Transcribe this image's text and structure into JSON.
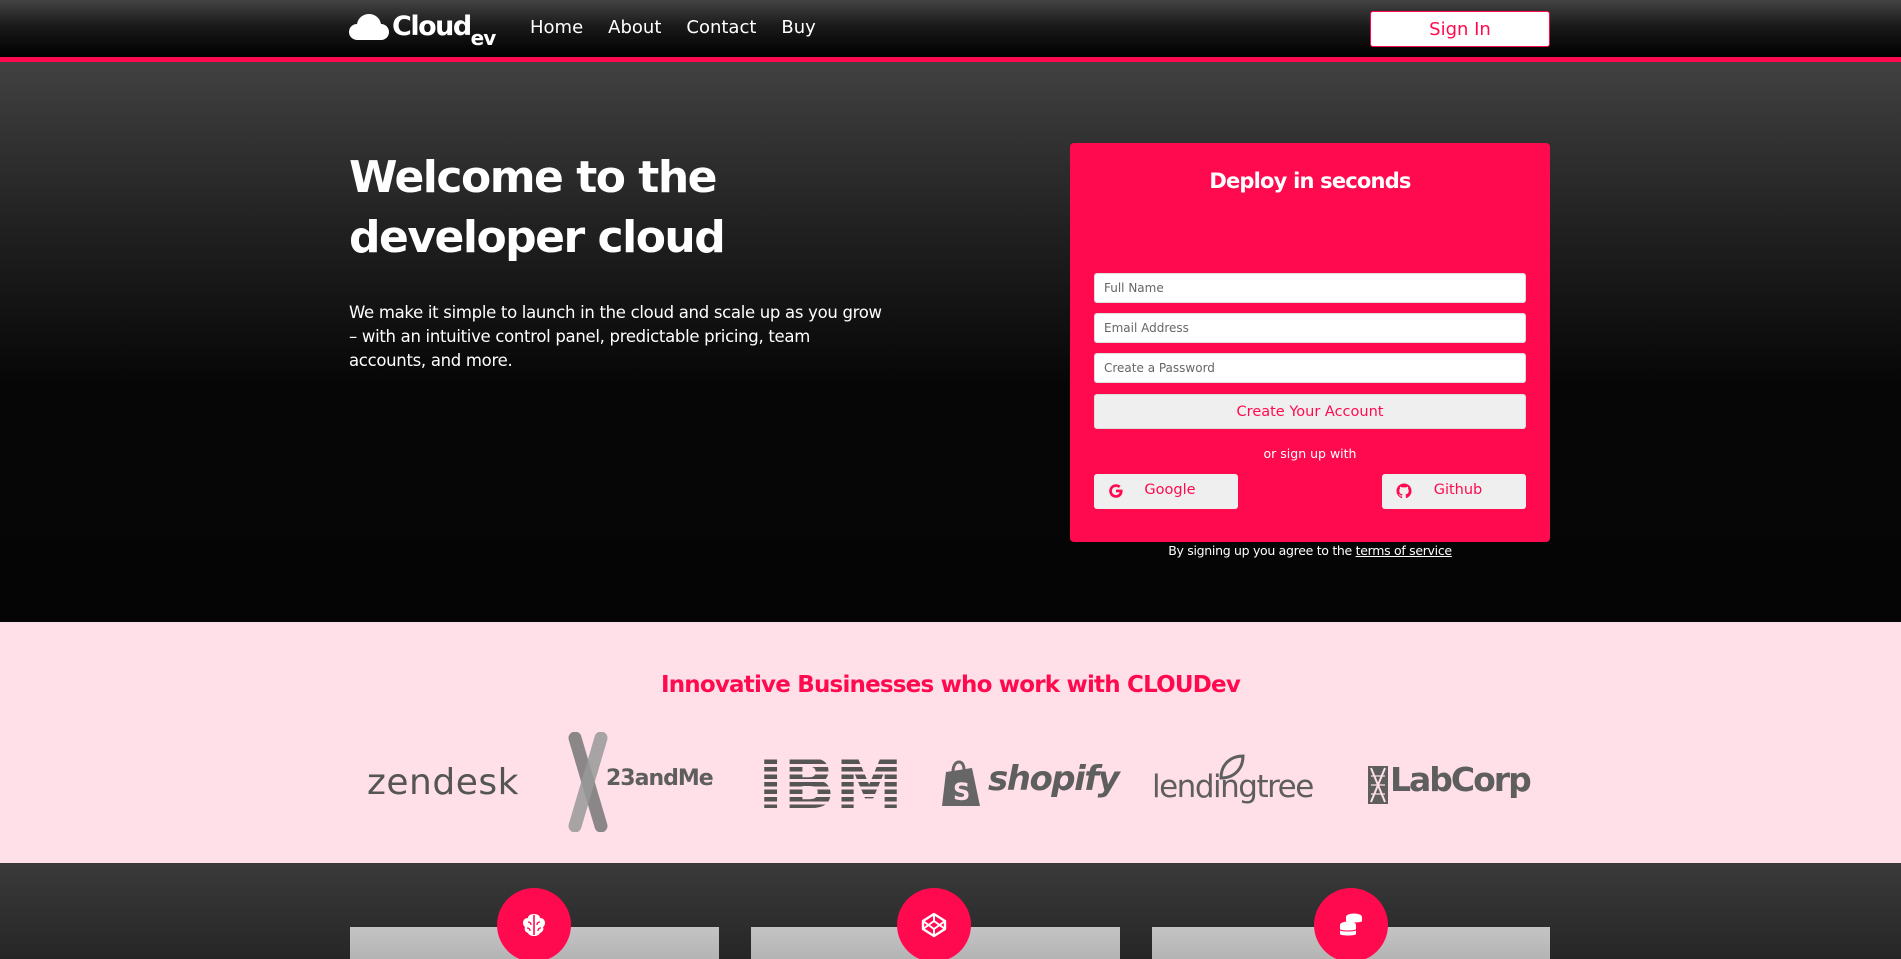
{
  "nav": {
    "brand_main": "Cloud",
    "brand_sub": "ev",
    "links": [
      "Home",
      "About",
      "Contact",
      "Buy"
    ],
    "signin_label": "Sign In"
  },
  "hero": {
    "title": "Welcome to the developer cloud",
    "text": "We make it simple to launch in the cloud and scale up as you grow – with an intuitive control panel, predictable pricing, team accounts, and more."
  },
  "signup": {
    "title": "Deploy in seconds",
    "fullname_placeholder": "Full Name",
    "email_placeholder": "Email Address",
    "password_placeholder": "Create a Password",
    "create_label": "Create Your Account",
    "or_text": "or sign up with",
    "google_label": "Google",
    "github_label": "Github",
    "terms_prefix": "By signing up you agree to the ",
    "terms_link": "terms of service"
  },
  "partners": {
    "title": "Innovative Businesses who work with CLOUDev",
    "logos": [
      "zendesk",
      "23andMe",
      "IBM",
      "shopify",
      "lendingtree",
      "LabCorp"
    ]
  },
  "features": {
    "icons": [
      "brain-icon",
      "codepen-icon",
      "coins-icon"
    ]
  },
  "colors": {
    "accent": "#ff0a4f",
    "partners_bg": "#ffe0e8"
  }
}
